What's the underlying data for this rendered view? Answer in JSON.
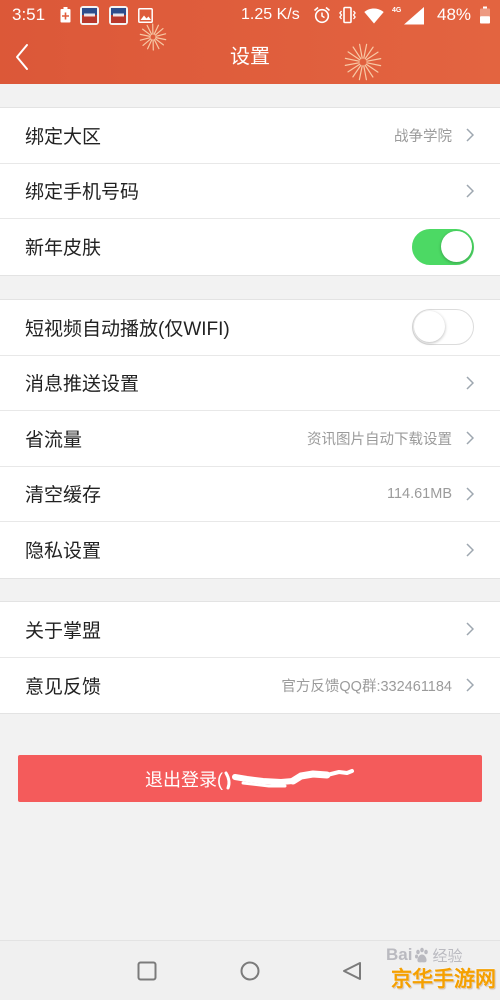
{
  "status_bar": {
    "time": "3:51",
    "net_speed": "1.25 K/s",
    "network_type": "4G",
    "battery_level": "48%",
    "left_icons": [
      "battery-saver-icon",
      "app-icon",
      "app-icon",
      "image-icon"
    ],
    "right_icons": [
      "alarm-icon",
      "vibrate-icon",
      "wifi-icon",
      "signal-icon",
      "battery-icon"
    ]
  },
  "header": {
    "title": "设置",
    "back_icon": "chevron-left-icon"
  },
  "sections": [
    {
      "rows": [
        {
          "label": "绑定大区",
          "value": "战争学院",
          "icon": "chevron-right-icon"
        },
        {
          "label": "绑定手机号码",
          "icon": "chevron-right-icon"
        },
        {
          "label": "新年皮肤",
          "toggle_on": true
        }
      ]
    },
    {
      "rows": [
        {
          "label": "短视频自动播放(仅WIFI)",
          "toggle_on": false
        },
        {
          "label": "消息推送设置",
          "icon": "chevron-right-icon"
        },
        {
          "label": "省流量",
          "value": "资讯图片自动下载设置",
          "icon": "chevron-right-icon"
        },
        {
          "label": "清空缓存",
          "value": "114.61MB",
          "icon": "chevron-right-icon"
        },
        {
          "label": "隐私设置",
          "icon": "chevron-right-icon"
        }
      ]
    },
    {
      "rows": [
        {
          "label": "关于掌盟",
          "icon": "chevron-right-icon"
        },
        {
          "label": "意见反馈",
          "value": "官方反馈QQ群:332461184",
          "icon": "chevron-right-icon"
        }
      ]
    }
  ],
  "logout_button": {
    "label": "退出登录("
  },
  "nav_bar": {
    "icons": [
      "recent-apps-icon",
      "home-icon",
      "back-icon"
    ]
  },
  "watermark": {
    "logo_left": "Bai",
    "logo_right": "经验",
    "site": "京华手游网"
  },
  "colors": {
    "header_bg": "#e15d3c",
    "toggle_on": "#4cd964",
    "logout_bg": "#f45b5b",
    "watermark": "#f5a000"
  }
}
